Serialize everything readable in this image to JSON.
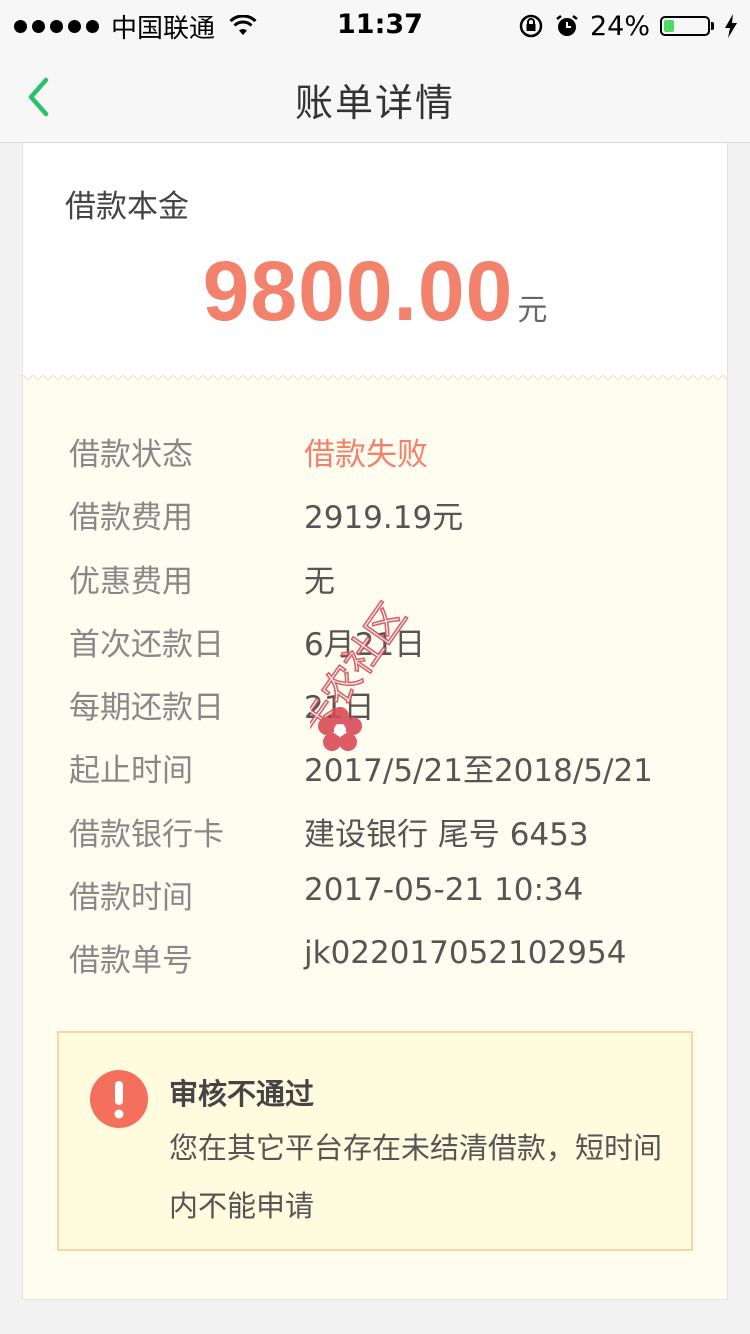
{
  "status_bar": {
    "carrier": "中国联通",
    "time": "11:37",
    "battery": "24%",
    "battery_level": 0.24
  },
  "nav": {
    "title": "账单详情"
  },
  "principal": {
    "label": "借款本金",
    "amount": "9800.00",
    "unit": "元"
  },
  "details": [
    {
      "key": "借款状态",
      "value": "借款失败",
      "highlight": true
    },
    {
      "key": "借款费用",
      "value": "2919.19元"
    },
    {
      "key": "优惠费用",
      "value": "无"
    },
    {
      "key": "首次还款日",
      "value": "6月21日"
    },
    {
      "key": "每期还款日",
      "value": "21日"
    },
    {
      "key": "起止时间",
      "value": "2017/5/21至2018/5/21"
    },
    {
      "key": "借款银行卡",
      "value": "建设银行 尾号 6453"
    },
    {
      "key": "借款时间",
      "value": "2017-05-21 10:34"
    },
    {
      "key": "借款单号",
      "value": "jk022017052102954"
    }
  ],
  "notice": {
    "title": "审核不通过",
    "text": "您在其它平台存在未结清借款，短时间内不能申请"
  },
  "watermark": {
    "text": "卡农社区"
  },
  "colors": {
    "accent_green": "#2bc06a",
    "amount_red": "#f2826c",
    "notice_border": "#f8d8a0",
    "card_bg": "#fffdf0"
  },
  "icons": {
    "back": "chevron-left-icon",
    "warning": "exclamation-circle-icon",
    "wifi": "wifi-icon",
    "lock": "rotation-lock-icon",
    "alarm": "alarm-icon",
    "charging": "bolt-icon"
  }
}
